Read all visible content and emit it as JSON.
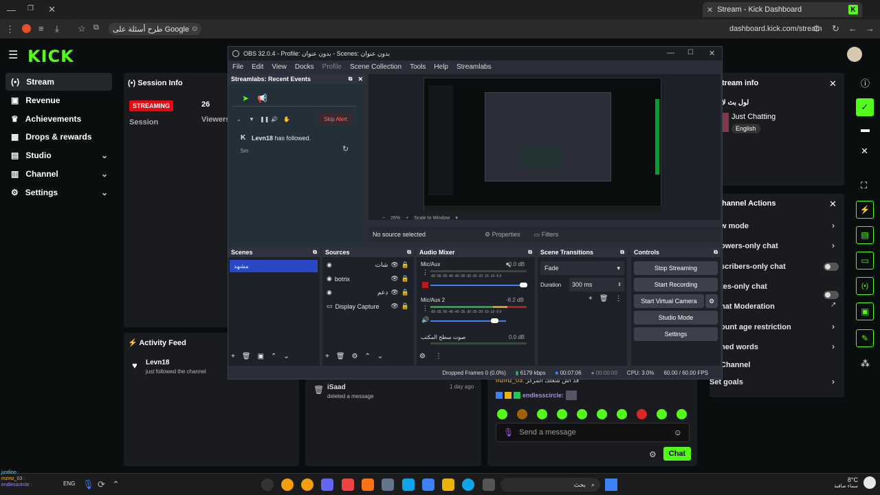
{
  "browser": {
    "tab_title": "Stream - Kick Dashboard",
    "search_chip": "طرح أسئلة على Google",
    "url": "dashboard.kick.com/stream",
    "kick_fav": "K"
  },
  "kick": {
    "logo": "KICK",
    "nav": [
      {
        "label": "Stream",
        "icon": "stream-icon"
      },
      {
        "label": "Revenue",
        "icon": "revenue-icon"
      },
      {
        "label": "Achievements",
        "icon": "trophy-icon"
      },
      {
        "label": "Drops & rewards",
        "icon": "gift-icon"
      },
      {
        "label": "Studio",
        "icon": "studio-icon"
      },
      {
        "label": "Channel",
        "icon": "channel-icon"
      },
      {
        "label": "Settings",
        "icon": "settings-icon"
      }
    ],
    "session": {
      "title": "Session Info",
      "badge": "STREAMING",
      "session_label": "Session",
      "viewers_count": "26",
      "viewers_label": "Viewers"
    },
    "activity": {
      "title": "Activity Feed",
      "user": "Levn18",
      "text": "just followed the channel"
    },
    "mod_log": {
      "user": "iSaad",
      "action": "deleted a message",
      "time": "1 day ago"
    },
    "stream_info": {
      "title": "tream info",
      "stream_title": "لول بث لا",
      "category": "Just Chatting",
      "language": "English"
    },
    "channel_actions": {
      "title": "hannel Actions",
      "items": [
        "w mode",
        "owers-only chat",
        "scribers-only chat",
        "tes-only chat",
        "hat Moderation",
        "ount age restriction",
        "ned words",
        "Channel",
        "Set goals"
      ]
    },
    "chat": {
      "placeholder": "Send a message",
      "send": "Chat",
      "user1": "mzmz_03:",
      "user1_msg": "قد اش شغلك المركز",
      "user2": "endlesscircle:"
    }
  },
  "obs": {
    "title": "OBS 32.0.4 - Profile: بدون عنوان - Scenes: بدون عنوان",
    "menu": [
      "File",
      "Edit",
      "View",
      "Docks",
      "Profile",
      "Scene Collection",
      "Tools",
      "Help",
      "Streamlabs"
    ],
    "events": {
      "title": "Streamlabs: Recent Events",
      "skip": "Skip Alert",
      "user": "Levn18",
      "text": "has followed.",
      "time": "5m"
    },
    "preview": {
      "zoom": "26%",
      "scale": "Scale to Window",
      "no_source": "No source selected",
      "properties": "Properties",
      "filters": "Filters"
    },
    "scenes": {
      "title": "Scenes",
      "items": [
        "مشهد"
      ]
    },
    "sources": {
      "title": "Sources",
      "items": [
        "شات",
        "botrix",
        "دعم",
        "Display Capture"
      ]
    },
    "mixer": {
      "title": "Audio Mixer",
      "ch1": "Mic/Aux",
      "ch1_db": "0.0 dB",
      "ch2": "Mic/Aux 2",
      "ch2_db": "-8.2 dB",
      "ch3": "صوت سطح المكتب",
      "ch3_db": "0.0 dB",
      "scale": "-60 -55 -50 -45 -40 -35 -30 -25 -20 -15 -10 -5 0"
    },
    "transitions": {
      "title": "Scene Transitions",
      "type": "Fade",
      "duration_label": "Duration",
      "duration": "300 ms"
    },
    "controls": {
      "title": "Controls",
      "buttons": [
        "Stop Streaming",
        "Start Recording",
        "Start Virtual Camera",
        "Studio Mode",
        "Settings"
      ]
    },
    "status": {
      "dropped": "Dropped Frames 0 (0.0%)",
      "kbps": "6179 kbps",
      "live_time": "00:07:06",
      "rec_time": "00:00:00",
      "cpu": "CPU: 3.0%",
      "fps": "60.00 / 60.00 FPS"
    }
  },
  "taskbar": {
    "search": "بحث",
    "lang": "ENG",
    "temp": "8°C",
    "weather": "سماء صافية",
    "chat1": "justlioo :",
    "chat2": "mzmz_03 :",
    "chat3": "endlesscircle :"
  },
  "colors": {
    "kick_green": "#53fc18",
    "streaming_red": "#e50914",
    "obs_scene_selected": "#2948c6"
  }
}
